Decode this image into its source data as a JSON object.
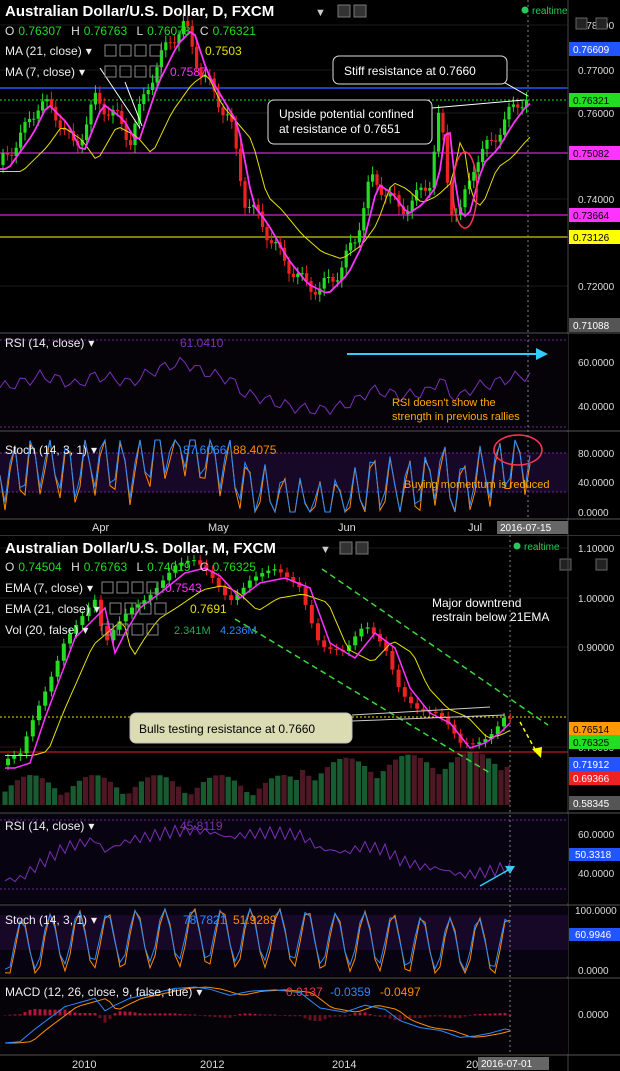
{
  "colors": {
    "bg": "#000000",
    "up": "#22dd22",
    "down": "#ee2222",
    "ma21": "#e8e000",
    "ma7": "#ff33ff",
    "rsi": "#8a2be2",
    "stoch_k": "#2b8cff",
    "stoch_d": "#ff8c00",
    "annot_orange": "#ffaa00",
    "channel": "#39d839",
    "arrow_cyan": "#33ccff",
    "callout_box": "#dcdcb4"
  },
  "daily": {
    "title": "Australian Dollar/U.S. Dollar, D, FXCM",
    "realtime": "realtime",
    "ohlc": {
      "o_label": "O",
      "o": "0.76307",
      "h_label": "H",
      "h": "0.76763",
      "l_label": "L",
      "l": "0.76078",
      "c_label": "C",
      "c": "0.76321"
    },
    "ma21_label": "MA (21, close)",
    "ma21_value": "0.7503",
    "ma7_label": "MA (7, close)",
    "ma7_value": "0.7587",
    "price_axis": [
      "0.78000",
      "0.77000",
      "0.76000",
      "0.74000",
      "0.72000"
    ],
    "price_tags": [
      {
        "text": "0.76609",
        "color": "#2255ff",
        "fg": "#ffffff"
      },
      {
        "text": "0.76321",
        "color": "#22dd22",
        "fg": "#000000"
      },
      {
        "text": "0.75082",
        "color": "#ff33ff",
        "fg": "#000000"
      },
      {
        "text": "0.73664",
        "color": "#ff33ff",
        "fg": "#000000"
      },
      {
        "text": "0.73126",
        "color": "#ffff00",
        "fg": "#000000"
      },
      {
        "text": "0.71088",
        "color": "#555555",
        "fg": "#ffffff"
      }
    ],
    "annotations": {
      "stiff": "Stiff resistance at 0.7660",
      "upside_1": "Upside potential confined",
      "upside_2": "at resistance of 0.7651",
      "rsi_note_1": "RSI doesn't show the",
      "rsi_note_2": "strength in previous rallies",
      "stoch_note": "Buying momentum is reduced"
    },
    "rsi": {
      "label": "RSI (14, close)",
      "value": "61.0410",
      "axis": [
        "60.0000",
        "40.0000"
      ]
    },
    "stoch": {
      "label": "Stoch (14, 3, 1)",
      "k": "87.6066",
      "d": "88.4075",
      "axis": [
        "80.0000",
        "40.0000",
        "0.0000"
      ]
    },
    "x_labels": [
      "Apr",
      "May",
      "Jun",
      "Jul"
    ],
    "date_tag": "2016-07-15"
  },
  "monthly": {
    "title": "Australian Dollar/U.S. Dollar, M, FXCM",
    "realtime": "realtime",
    "ohlc": {
      "o_label": "O",
      "o": "0.74504",
      "h_label": "H",
      "h": "0.76763",
      "l_label": "L",
      "l": "0.74019",
      "c_label": "C",
      "c": "0.76325"
    },
    "ema7_label": "EMA (7, close)",
    "ema7_value": "0.7543",
    "ema21_label": "EMA (21, close)",
    "ema21_value": "0.7691",
    "vol_label": "Vol (20, false)",
    "vol_v1": "2.341M",
    "vol_v2": "4.236M",
    "price_axis": [
      "1.10000",
      "1.00000",
      "0.90000",
      "0.70000"
    ],
    "price_tags": [
      {
        "text": "0.76514",
        "color": "#ff9900",
        "fg": "#000000"
      },
      {
        "text": "0.76325",
        "color": "#22dd22",
        "fg": "#000000"
      },
      {
        "text": "0.71912",
        "color": "#2255ff",
        "fg": "#ffffff"
      },
      {
        "text": "0.69366",
        "color": "#ee2222",
        "fg": "#ffffff"
      },
      {
        "text": "0.58345",
        "color": "#555555",
        "fg": "#ffffff"
      }
    ],
    "annotations": {
      "downtrend_1": "Major downtrend",
      "downtrend_2": "restrain below 21EMA",
      "bulls": "Bulls testing resistance at 0.7660"
    },
    "rsi": {
      "label": "RSI (14, close)",
      "value": "45.8119",
      "tag": "50.3318",
      "axis": [
        "60.0000",
        "40.0000"
      ]
    },
    "stoch": {
      "label": "Stoch (14, 3, 1)",
      "k": "78.7821",
      "d": "51.9289",
      "tag": "60.9946",
      "axis": [
        "100.0000",
        "0.0000"
      ]
    },
    "macd": {
      "label": "MACD (12, 26, close, 9, false, true)",
      "v1": "0.0137",
      "v2": "-0.0359",
      "v3": "-0.0497",
      "axis": [
        "0.0000"
      ]
    },
    "x_labels": [
      "2010",
      "2012",
      "2014",
      "20"
    ],
    "date_tag": "2016-07-01"
  }
}
